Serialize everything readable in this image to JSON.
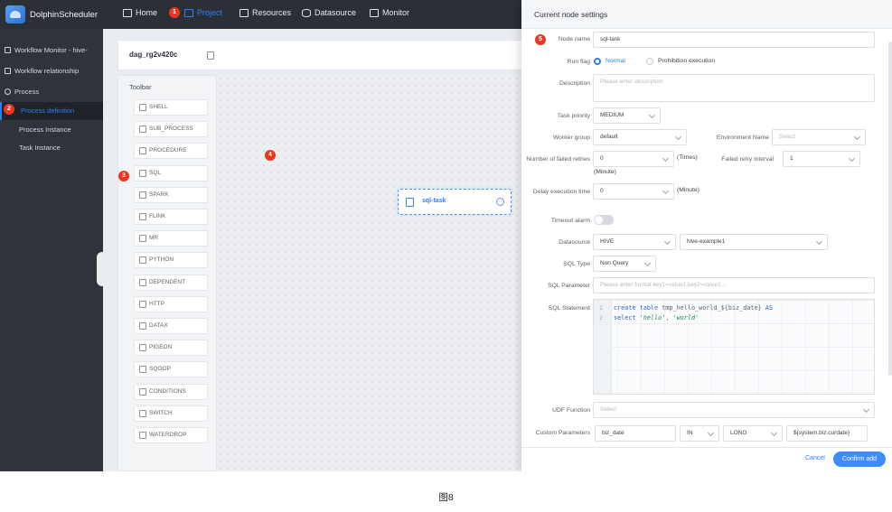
{
  "app": {
    "name": "DolphinScheduler"
  },
  "topnav": [
    {
      "label": "Home",
      "icon": "home-icon"
    },
    {
      "label": "Project",
      "icon": "project-icon",
      "active": true
    },
    {
      "label": "Resources",
      "icon": "folder-icon"
    },
    {
      "label": "Datasource",
      "icon": "database-icon"
    },
    {
      "label": "Monitor",
      "icon": "monitor-icon"
    }
  ],
  "sidebar": {
    "items": [
      {
        "label": "Workflow Monitor - hive-"
      },
      {
        "label": "Workflow relationship"
      },
      {
        "label": "Process"
      },
      {
        "label": "Process definition",
        "selected": true
      },
      {
        "label": "Process Instance"
      },
      {
        "label": "Task Instance"
      }
    ]
  },
  "badges": [
    "1",
    "2",
    "3",
    "4",
    "5"
  ],
  "dag": {
    "name": "dag_rg2v420c"
  },
  "toolbar": {
    "title": "Toolbar",
    "tools": [
      "SHELL",
      "SUB_PROCESS",
      "PROCEDURE",
      "SQL",
      "SPARK",
      "FLINK",
      "MR",
      "PYTHON",
      "DEPENDENT",
      "HTTP",
      "DATAX",
      "PIGEON",
      "SQOOP",
      "CONDITIONS",
      "SWITCH",
      "WATERDROP"
    ]
  },
  "node": {
    "label": "sql-task"
  },
  "panel": {
    "title": "Current node settings",
    "node_name": {
      "label": "Node name",
      "value": "sql-task"
    },
    "run_flag": {
      "label": "Run flag",
      "options": [
        "Normal",
        "Prohibition execution"
      ],
      "selected": "Normal"
    },
    "description": {
      "label": "Description",
      "placeholder": "Please enter description"
    },
    "task_priority": {
      "label": "Task priority",
      "value": "MEDIUM"
    },
    "worker_group": {
      "label": "Worker group",
      "value": "default"
    },
    "environment": {
      "label": "Environment Name",
      "placeholder": "Select"
    },
    "failed_retries": {
      "label": "Number of failed retries",
      "value": "0",
      "unit": "(Times)"
    },
    "retry_interval": {
      "label": "Failed retry interval",
      "value": "1",
      "unit": "(Minute)"
    },
    "delay_time": {
      "label": "Delay execution time",
      "value": "0",
      "unit": "(Minute)"
    },
    "timeout_alarm": {
      "label": "Timeout alarm",
      "on": false
    },
    "datasource": {
      "label": "Datasource",
      "type": "HIVE",
      "name": "hive-example1"
    },
    "sql_type": {
      "label": "SQL Type",
      "value": "Non Query"
    },
    "sql_parameter": {
      "label": "SQL Parameter",
      "placeholder": "Please enter format key1=value1;key2=value2..."
    },
    "sql_statement": {
      "label": "SQL Statement",
      "line_numbers": [
        "1",
        "2"
      ],
      "lines": [
        [
          {
            "t": "create table ",
            "c": "kw"
          },
          {
            "t": "tmp_hello_world_${biz_date} ",
            "c": "plain"
          },
          {
            "t": "AS",
            "c": "kw"
          }
        ],
        [
          {
            "t": "select ",
            "c": "kw"
          },
          {
            "t": "'hello'",
            "c": "str"
          },
          {
            "t": ", ",
            "c": "plain"
          },
          {
            "t": "'world'",
            "c": "str"
          }
        ]
      ]
    },
    "udf_function": {
      "label": "UDF Function",
      "placeholder": "Select"
    },
    "custom_parameters": {
      "label": "Custom Parameters",
      "prop": "biz_date",
      "direct": "IN",
      "type": "LONG",
      "value": "${system.biz.curdate}"
    },
    "cancel_label": "Cancel",
    "confirm_label": "Confirm add"
  },
  "caption": "图8",
  "colors": {
    "accent": "#2f7df6",
    "badge": "#e8361f",
    "topbar": "#2b2f36",
    "sidebar": "#2f333a"
  }
}
